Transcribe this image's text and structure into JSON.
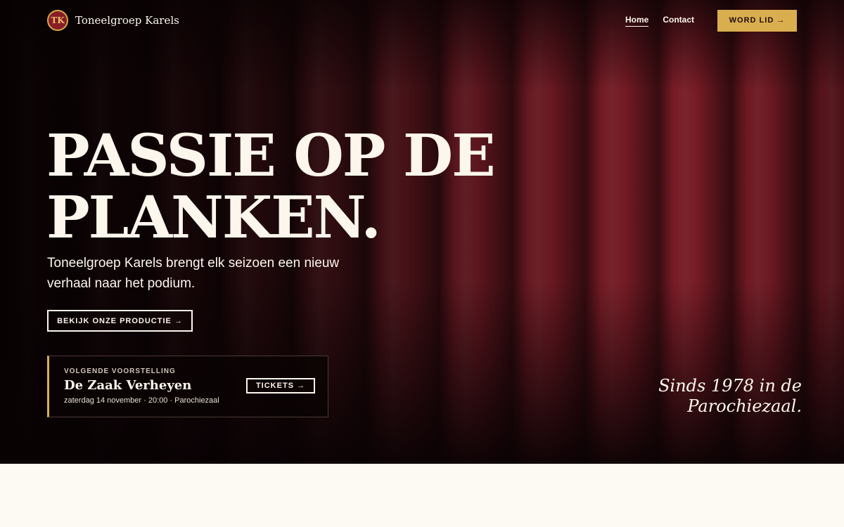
{
  "header": {
    "logo_text": "TK",
    "brand_name": "Toneelgroep Karels",
    "nav": [
      {
        "label": "Home",
        "active": true
      },
      {
        "label": "Contact",
        "active": false
      }
    ],
    "join_label": "WORD LID →"
  },
  "hero": {
    "headline_line1": "PASSIE OP DE",
    "headline_line2": "PLANKEN.",
    "lede": "Toneelgroep Karels brengt elk seizoen een nieuw verhaal naar het podium.",
    "cta_label": "BEKIJK ONZE PRODUCTIE →",
    "since_line1": "Sinds 1978 in de",
    "since_line2": "Parochiezaal."
  },
  "next_show": {
    "eyebrow": "VOLGENDE VOORSTELLING",
    "title": "De Zaak Verheyen",
    "meta": "zaterdag 14 november · 20:00 · Parochiezaal",
    "tickets_label": "TICKETS →"
  },
  "colors": {
    "accent_gold": "#d9ae4f",
    "curtain_red": "#7a1c26",
    "cream": "#fdf9f3"
  }
}
